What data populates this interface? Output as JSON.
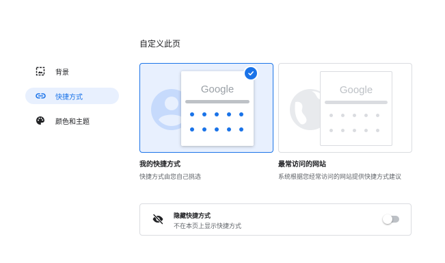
{
  "sidebar": {
    "items": [
      {
        "label": "背景",
        "icon": "background-icon",
        "active": false
      },
      {
        "label": "快捷方式",
        "icon": "link-icon",
        "active": true
      },
      {
        "label": "颜色和主题",
        "icon": "palette-icon",
        "active": false
      }
    ]
  },
  "main": {
    "title": "自定义此页",
    "options": [
      {
        "title": "我的快捷方式",
        "description": "快捷方式由您自己挑选",
        "preview_text": "Google",
        "selected": true
      },
      {
        "title": "最常访问的网站",
        "description": "系统根据您经常访问的网站提供快捷方式建议",
        "preview_text": "Google",
        "selected": false
      }
    ],
    "hide_row": {
      "title": "隐藏快捷方式",
      "subtitle": "不在本页上显示快捷方式",
      "icon": "eye-off-icon",
      "enabled": false
    }
  },
  "colors": {
    "accent": "#1a73e8",
    "selected_bg": "#e8f0fe",
    "muted_text": "#5f6368"
  }
}
